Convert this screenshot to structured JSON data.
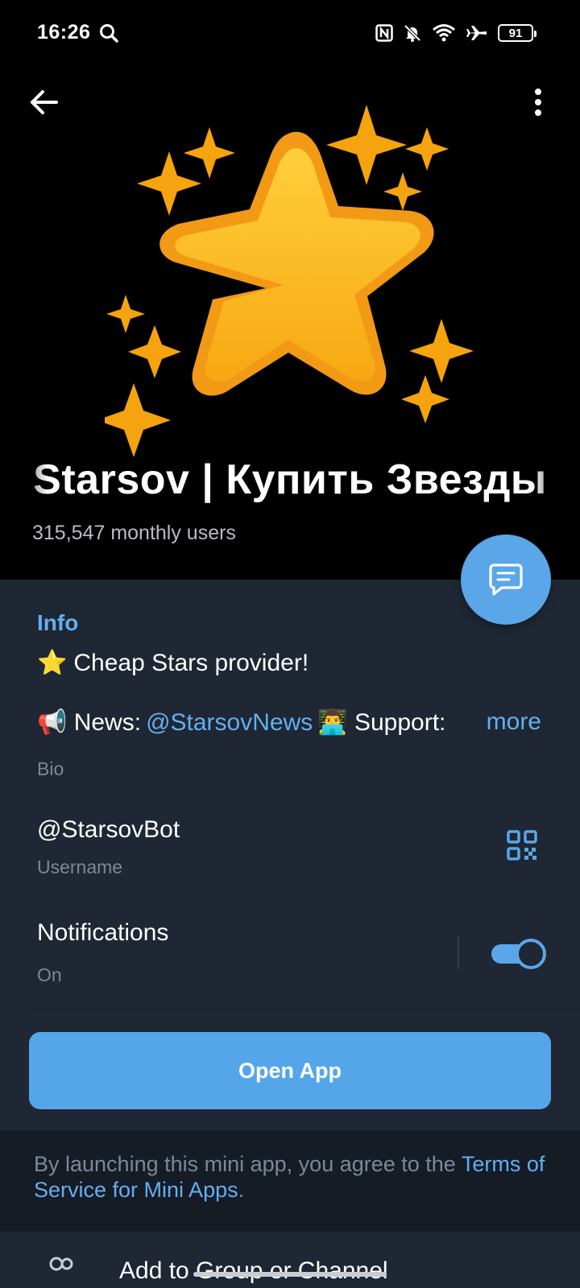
{
  "status_bar": {
    "time": "16:26",
    "battery": "91",
    "icons": [
      "search-icon",
      "nfc-icon",
      "bell-off-icon",
      "wifi-icon",
      "airplane-icon",
      "battery-icon"
    ]
  },
  "header": {
    "title": "Starsov | Купить Звезды",
    "subtitle": "315,547 monthly users",
    "back_icon": "arrow-left-icon",
    "menu_icon": "more-vert-icon"
  },
  "colors": {
    "accent": "#5aa6e8",
    "panel": "#1e2733",
    "star_yellow": "#f9b81b",
    "star_orange": "#f29a16"
  },
  "info": {
    "section_title": "Info",
    "bio_line1_emoji": "⭐",
    "bio_line1_text": "Cheap Stars provider!",
    "bio_line2_emoji": "📢",
    "bio_line2_prefix": "News:",
    "bio_line2_link": "@StarsovNews",
    "bio_line2_emoji2": "👨‍💻",
    "bio_line2_suffix": "Support:",
    "bio_more": "more",
    "bio_label": "Bio",
    "username": "@StarsovBot",
    "username_label": "Username",
    "notifications_title": "Notifications",
    "notifications_state": "On",
    "notifications_enabled": true
  },
  "open_app": {
    "label": "Open App"
  },
  "terms": {
    "text": "By launching this mini app, you agree to the ",
    "link": "Terms of Service for Mini Apps",
    "end": "."
  },
  "bottom_row": {
    "text": "Add to Group or Channel"
  }
}
